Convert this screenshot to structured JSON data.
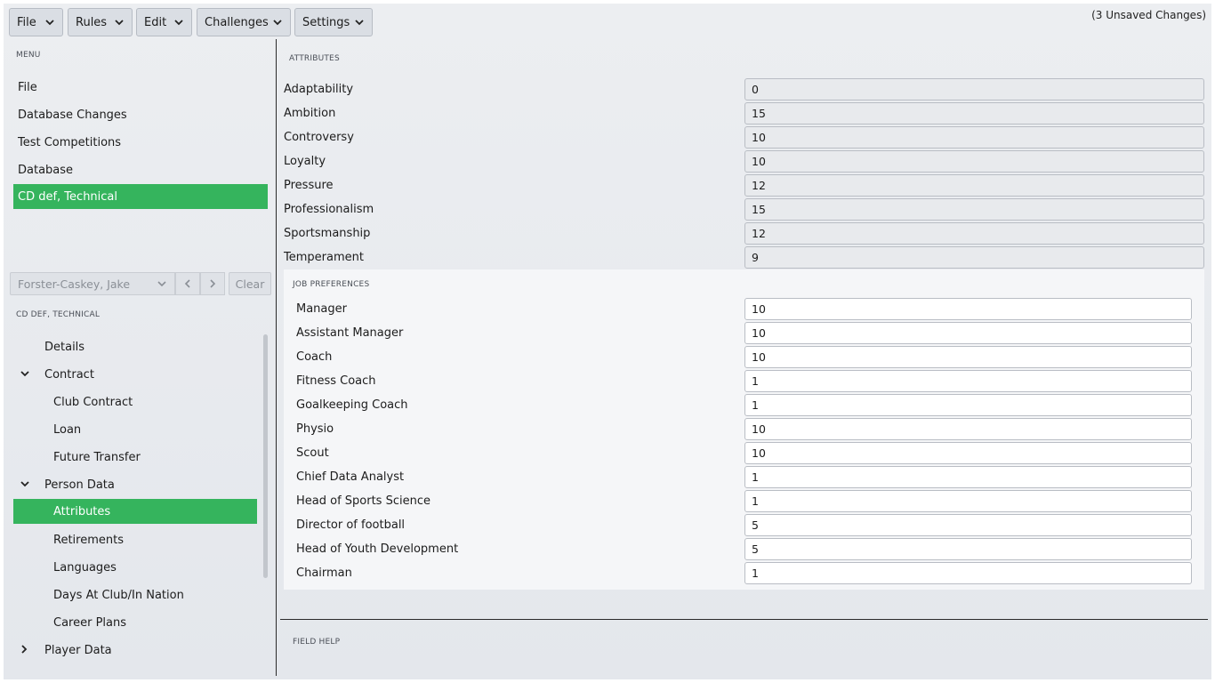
{
  "toolbar": {
    "menus": [
      "File",
      "Rules",
      "Edit",
      "Challenges",
      "Settings"
    ],
    "unsaved": "(3 Unsaved Changes)"
  },
  "sidebar": {
    "menu_label": "MENU",
    "items": [
      "File",
      "Database Changes",
      "Test Competitions",
      "Database",
      "CD def, Technical"
    ],
    "active_index": 4,
    "person_select": "Forster-Caskey, Jake",
    "clear_label": "Clear",
    "section_label": "CD DEF, TECHNICAL",
    "tree": [
      {
        "label": "Details"
      },
      {
        "label": "Contract"
      },
      {
        "label": "Club Contract"
      },
      {
        "label": "Loan"
      },
      {
        "label": "Future Transfer"
      },
      {
        "label": "Person Data"
      },
      {
        "label": "Attributes"
      },
      {
        "label": "Retirements"
      },
      {
        "label": "Languages"
      },
      {
        "label": "Days At Club/In Nation"
      },
      {
        "label": "Career Plans"
      },
      {
        "label": "Player Data"
      }
    ]
  },
  "main": {
    "attributes_label": "ATTRIBUTES",
    "attributes": [
      {
        "label": "Adaptability",
        "value": "0"
      },
      {
        "label": "Ambition",
        "value": "15"
      },
      {
        "label": "Controversy",
        "value": "10"
      },
      {
        "label": "Loyalty",
        "value": "10"
      },
      {
        "label": "Pressure",
        "value": "12"
      },
      {
        "label": "Professionalism",
        "value": "15"
      },
      {
        "label": "Sportsmanship",
        "value": "12"
      },
      {
        "label": "Temperament",
        "value": "9"
      }
    ],
    "job_label": "JOB PREFERENCES",
    "jobs": [
      {
        "label": "Manager",
        "value": "10"
      },
      {
        "label": "Assistant Manager",
        "value": "10"
      },
      {
        "label": "Coach",
        "value": "10"
      },
      {
        "label": "Fitness Coach",
        "value": "1"
      },
      {
        "label": "Goalkeeping Coach",
        "value": "1"
      },
      {
        "label": "Physio",
        "value": "10"
      },
      {
        "label": "Scout",
        "value": "10"
      },
      {
        "label": "Chief Data Analyst",
        "value": "1"
      },
      {
        "label": "Head of Sports Science",
        "value": "1"
      },
      {
        "label": "Director of football",
        "value": "5"
      },
      {
        "label": "Head of Youth Development",
        "value": "5"
      },
      {
        "label": "Chairman",
        "value": "1"
      }
    ],
    "field_help_label": "FIELD HELP"
  },
  "colors": {
    "accent": "#35b45d",
    "background": "#e4e7ec"
  }
}
